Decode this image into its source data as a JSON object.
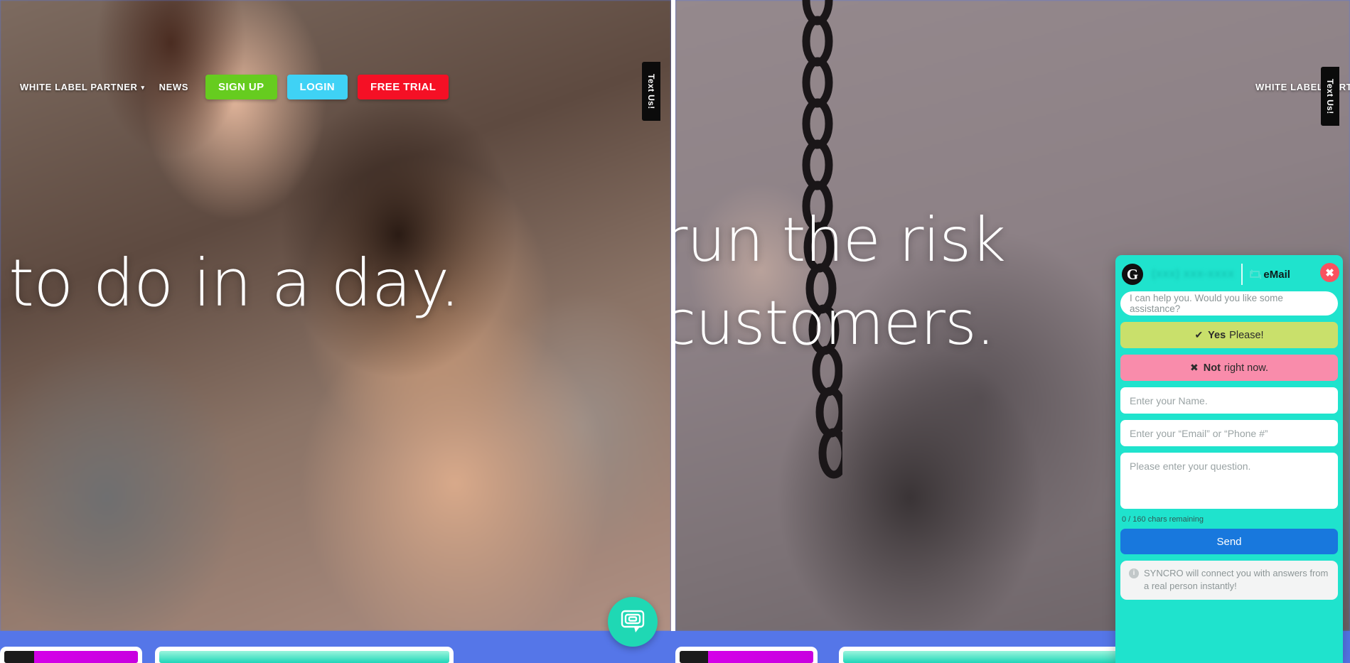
{
  "nav": {
    "partner_label": "WHITE LABEL PARTNER",
    "caret": "▾",
    "news_label": "NEWS",
    "signup_label": "SIGN UP",
    "login_label": "LOGIN",
    "trial_label": "FREE TRIAL",
    "colors": {
      "signup": "#66cc1f",
      "login": "#3fd2f5",
      "trial": "#f51025"
    }
  },
  "hero_left": {
    "headline": "to do in a day."
  },
  "hero_right": {
    "headline_line1": "run the risk",
    "headline_line2": "customers."
  },
  "text_us_tab": {
    "label": "Text Us!"
  },
  "chat_fab": {
    "icon": "chat-bubble-icon"
  },
  "chat_widget": {
    "brand_initial": "G",
    "phone_number": "(xxx) xxx-xxxx",
    "email_tab_label": "eMail",
    "email_icon": "envelope-icon",
    "close_label": "✖",
    "greeting": "I can help you. Would you like some assistance?",
    "yes_glyph": "✔",
    "yes_strong": "Yes",
    "yes_rest": "Please!",
    "no_glyph": "✖",
    "no_strong": "Not",
    "no_rest": "right now.",
    "name_placeholder": "Enter your Name.",
    "contact_placeholder": "Enter your “Email” or “Phone #”",
    "question_placeholder": "Please enter your question.",
    "name_value": "",
    "contact_value": "",
    "question_value": "",
    "char_counter": "0 / 160 chars remaining",
    "send_label": "Send",
    "info_glyph": "i",
    "footer_note": "SYNCRO will connect you with answers from a real person instantly!",
    "colors": {
      "panel": "#1fe3cd",
      "yes": "#c9e06b",
      "no": "#f98cab",
      "send": "#1878dd",
      "close": "#f9525f"
    }
  },
  "page": {
    "background_color": "#5576e8"
  }
}
